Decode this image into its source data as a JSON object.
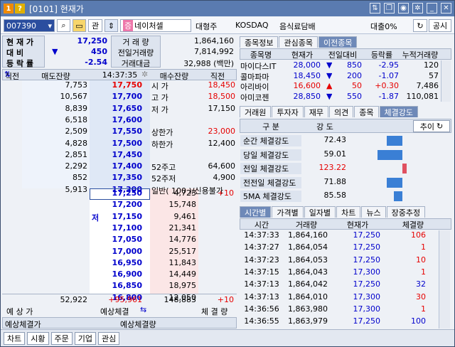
{
  "window": {
    "badge1": "1",
    "badge2": "?",
    "title": "[0101] 현재가"
  },
  "toolbar": {
    "code": "007390",
    "btn1": "관",
    "btn2": "증",
    "name": "네이처셀",
    "size": "대형주",
    "market": "KOSDAQ",
    "industry": "음식료담배",
    "loan": "대출0%",
    "notice": "공시"
  },
  "summary": {
    "price_label": "현 재 가",
    "price": "17,250",
    "change_label": "대 비",
    "change": "450",
    "rate_label": "등 락 률",
    "rate": "-2.54",
    "vol_label": "거 래 량",
    "vol": "1,864,160",
    "prev_label": "전일거래량",
    "prev": "7,814,992",
    "amt_label": "거래대금",
    "amt": "32,988 (백만)"
  },
  "ob": {
    "head": [
      "직전",
      "매도잔량",
      "14:37:35",
      "매수잔량",
      "직전"
    ],
    "asks": [
      [
        "7,753",
        "17,750"
      ],
      [
        "10,567",
        "17,700"
      ],
      [
        "8,839",
        "17,650"
      ],
      [
        "6,518",
        "17,600"
      ],
      [
        "2,509",
        "17,550"
      ],
      [
        "4,828",
        "17,500"
      ],
      [
        "2,851",
        "17,450"
      ],
      [
        "2,292",
        "17,400"
      ],
      [
        "852",
        "17,350"
      ],
      [
        "5,913",
        "17,300"
      ]
    ],
    "bids": [
      [
        "17,250",
        "4,723",
        "+10"
      ],
      [
        "17,200",
        "15,748",
        ""
      ],
      [
        "17,150",
        "9,461",
        ""
      ],
      [
        "17,100",
        "21,341",
        ""
      ],
      [
        "17,050",
        "14,776",
        ""
      ],
      [
        "17,000",
        "25,517",
        ""
      ],
      [
        "16,950",
        "11,843",
        ""
      ],
      [
        "16,900",
        "14,449",
        ""
      ],
      [
        "16,850",
        "18,975",
        ""
      ],
      [
        "16,800",
        "12,050",
        ""
      ]
    ],
    "info": [
      [
        "시 가",
        "18,450"
      ],
      [
        "고 가",
        "18,500"
      ],
      [
        "저 가",
        "17,150"
      ],
      [
        "",
        ""
      ],
      [
        "상한가",
        "23,000"
      ],
      [
        "하한가",
        "12,400"
      ],
      [
        "",
        ""
      ],
      [
        "52주고",
        "64,600"
      ],
      [
        "52주저",
        "4,900"
      ],
      [
        "일반( 100 )/신용불가",
        ""
      ]
    ],
    "low_mark": "저",
    "tot_ask": "52,922",
    "tot_diff": "+95,961",
    "tot_bid": "148,883",
    "tot_bid_diff": "+10",
    "foot1": "예 상 가",
    "foot2": "예상체결",
    "foot3": "체 결 량"
  },
  "expect": {
    "l1": "예상체결가",
    "l2": "예상체결량"
  },
  "rtabs": [
    "종목정보",
    "관심종목",
    "이전종목"
  ],
  "related": {
    "head": [
      "종목명",
      "현재가",
      "전일대비",
      "등락률",
      "누적거래량"
    ],
    "rows": [
      [
        "마이다스IT",
        "28,000",
        "▼",
        "850",
        "-2.95",
        "120"
      ],
      [
        "콜마파마",
        "18,450",
        "▼",
        "200",
        "-1.07",
        "57"
      ],
      [
        "아리바이",
        "16,600",
        "▲",
        "50",
        "+0.30",
        "7,486"
      ],
      [
        "아미코젠",
        "28,850",
        "▼",
        "550",
        "-1.87",
        "110,081"
      ]
    ]
  },
  "stabs": [
    "거래원",
    "투자자",
    "재무",
    "의견",
    "종목",
    "체결강도"
  ],
  "strength": {
    "head": [
      "구 분",
      "강 도"
    ],
    "btn": "추이",
    "rows": [
      [
        "순간 체결강도",
        "72.43",
        0.22,
        "#3a7fd5"
      ],
      [
        "당일 체결강도",
        "59.01",
        0.35,
        "#3a7fd5"
      ],
      [
        "전일 체결강도",
        "123.22",
        0.06,
        "#e05060"
      ],
      [
        "전전일 체결강도",
        "71.88",
        0.22,
        "#3a7fd5"
      ],
      [
        "5MA 체결강도",
        "85.58",
        0.12,
        "#3a7fd5"
      ]
    ]
  },
  "ttabs": [
    "시간별",
    "가격별",
    "일자별",
    "차트",
    "뉴스",
    "장중추정"
  ],
  "trades": {
    "head": [
      "시간",
      "거래량",
      "현재가",
      "체결량"
    ],
    "rows": [
      [
        "14:37:33",
        "1,864,160",
        "17,250",
        "106",
        "r"
      ],
      [
        "14:37:27",
        "1,864,054",
        "17,250",
        "1",
        "r"
      ],
      [
        "14:37:23",
        "1,864,053",
        "17,250",
        "10",
        "r"
      ],
      [
        "14:37:15",
        "1,864,043",
        "17,300",
        "1",
        "r"
      ],
      [
        "14:37:13",
        "1,864,042",
        "17,250",
        "32",
        "b"
      ],
      [
        "14:37:13",
        "1,864,010",
        "17,300",
        "30",
        "r"
      ],
      [
        "14:36:56",
        "1,863,980",
        "17,300",
        "1",
        "r"
      ],
      [
        "14:36:55",
        "1,863,979",
        "17,250",
        "100",
        "b"
      ]
    ]
  },
  "bottom": [
    "차트",
    "시황",
    "주문",
    "기업",
    "관심"
  ]
}
